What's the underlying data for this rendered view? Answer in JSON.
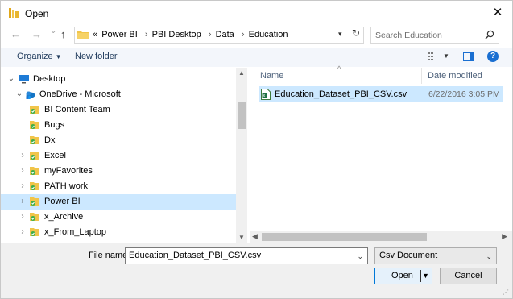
{
  "window": {
    "title": "Open",
    "close_glyph": "✕"
  },
  "nav": {
    "back_glyph": "←",
    "forward_glyph": "→",
    "recent_glyph": "⌄",
    "up_glyph": "↑",
    "breadcrumb_overflow": "«",
    "breadcrumbs": [
      "Power BI",
      "PBI Desktop",
      "Data",
      "Education"
    ],
    "crumb_separator": "›",
    "refresh_glyph": "↻",
    "search_placeholder": "Search Education"
  },
  "toolbar": {
    "organize_label": "Organize",
    "new_folder_label": "New folder",
    "help_glyph": "?"
  },
  "tree": [
    {
      "label": "Desktop",
      "icon": "desktop-icon",
      "chevron": "⌄",
      "indent": 0
    },
    {
      "label": "OneDrive - Microsoft",
      "icon": "onedrive-icon",
      "chevron": "⌄",
      "indent": 1
    },
    {
      "label": "BI Content Team",
      "icon": "synced-folder-icon",
      "chevron": "",
      "indent": 2
    },
    {
      "label": "Bugs",
      "icon": "synced-folder-icon",
      "chevron": "",
      "indent": 2
    },
    {
      "label": "Dx",
      "icon": "synced-folder-icon",
      "chevron": "",
      "indent": 2
    },
    {
      "label": "Excel",
      "icon": "synced-folder-icon",
      "chevron": "›",
      "indent": 2
    },
    {
      "label": "myFavorites",
      "icon": "synced-folder-icon",
      "chevron": "›",
      "indent": 2
    },
    {
      "label": "PATH work",
      "icon": "synced-folder-icon",
      "chevron": "›",
      "indent": 2
    },
    {
      "label": "Power BI",
      "icon": "synced-folder-icon",
      "chevron": "›",
      "indent": 2,
      "selected": true
    },
    {
      "label": "x_Archive",
      "icon": "synced-folder-icon",
      "chevron": "›",
      "indent": 2
    },
    {
      "label": "x_From_Laptop",
      "icon": "synced-folder-icon",
      "chevron": "›",
      "indent": 2
    }
  ],
  "files": {
    "columns": {
      "name": "Name",
      "date": "Date modified"
    },
    "rows": [
      {
        "name": "Education_Dataset_PBI_CSV.csv",
        "date": "6/22/2016 3:05 PM",
        "icon": "csv-file-icon"
      }
    ]
  },
  "bottom": {
    "file_name_label": "File name:",
    "file_name_value": "Education_Dataset_PBI_CSV.csv",
    "file_type_value": "Csv Document",
    "open_label": "Open",
    "cancel_label": "Cancel"
  },
  "colors": {
    "selection": "#cce8ff",
    "accent": "#0078d7",
    "folder_yellow": "#f1c54a",
    "sync_green": "#3fae49"
  }
}
